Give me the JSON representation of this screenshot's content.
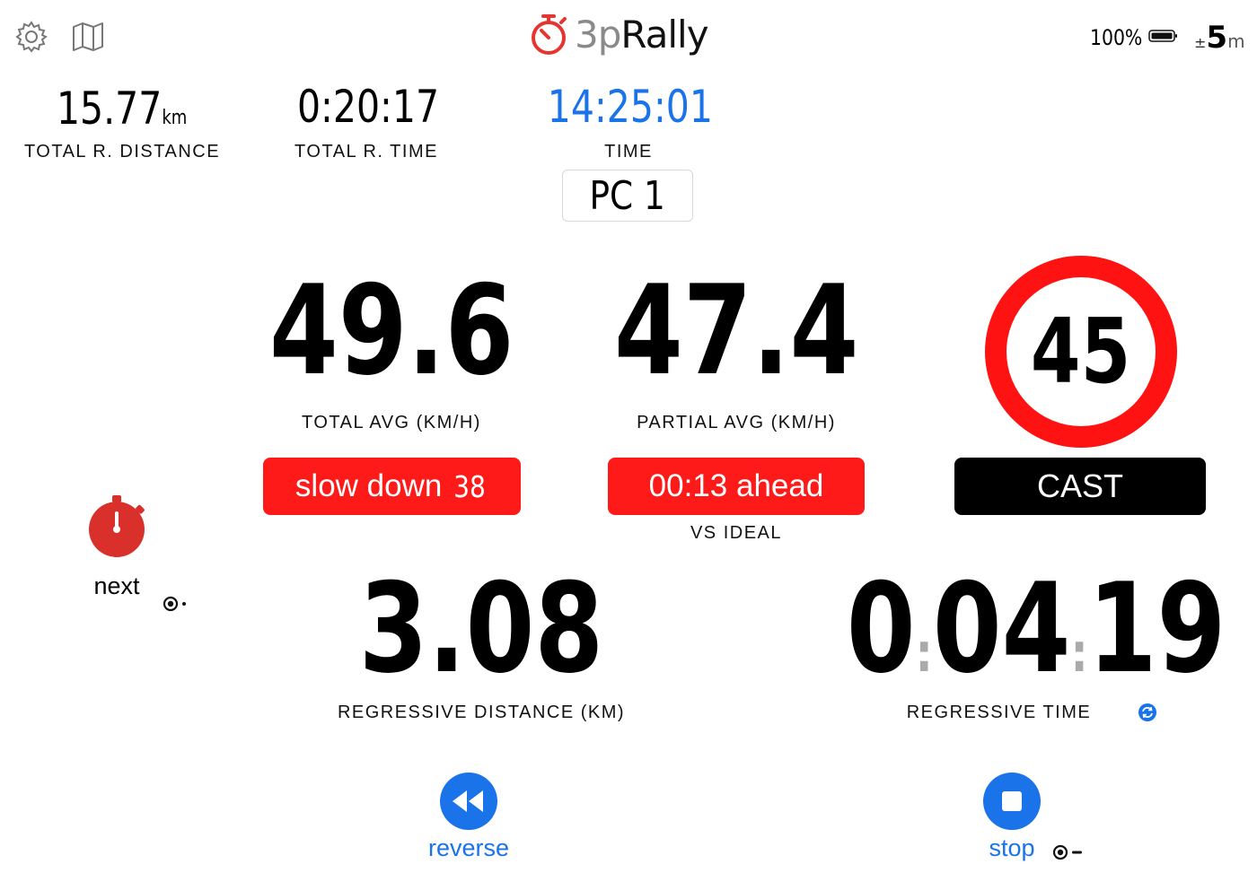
{
  "header": {
    "logo_prefix": "3p",
    "logo_suffix": "Rally",
    "battery": "100%",
    "accuracy_prefix": "±",
    "accuracy_value": "5",
    "accuracy_unit": "m"
  },
  "stats": {
    "total_distance": {
      "value": "15.77",
      "unit": "km",
      "label": "TOTAL R. DISTANCE"
    },
    "total_time": {
      "value": "0:20:17",
      "label": "TOTAL R. TIME"
    },
    "time": {
      "value": "14:25:01",
      "label": "TIME"
    },
    "stage": "PC 1"
  },
  "speeds": {
    "total_avg": {
      "value": "49.6",
      "label": "TOTAL AVG (KM/H)"
    },
    "partial_avg": {
      "value": "47.4",
      "label": "PARTIAL AVG (KM/H)"
    },
    "speed_limit": "45"
  },
  "alerts": {
    "slow_down_text": "slow down",
    "slow_down_value": "38",
    "ahead_text": "00:13 ahead",
    "vs_ideal": "VS IDEAL",
    "cast": "CAST"
  },
  "regressive": {
    "distance_value": "3.08",
    "distance_label": "REGRESSIVE DISTANCE (KM)",
    "time_h": "0",
    "time_m": "04",
    "time_s": "19",
    "time_sep": ":",
    "time_label": "REGRESSIVE TIME"
  },
  "controls": {
    "next": "next",
    "reverse": "reverse",
    "stop": "stop"
  },
  "colors": {
    "accent_blue": "#1a73e8",
    "alert_red": "#ff1a1a",
    "timer_red": "#d9302b"
  }
}
